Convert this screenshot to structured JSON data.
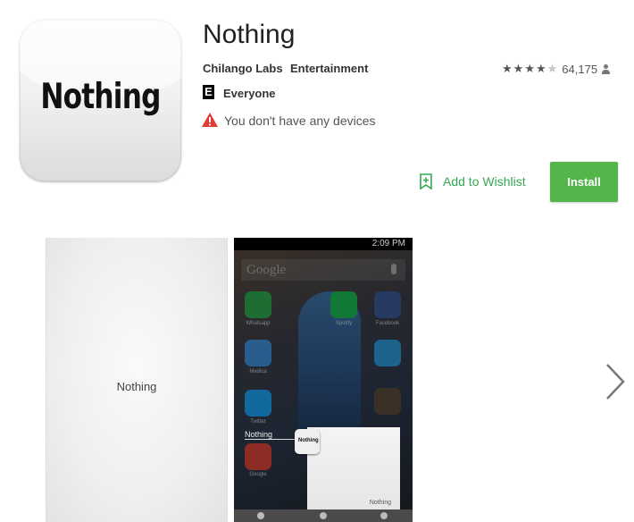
{
  "app": {
    "icon_text": "Nothing",
    "title": "Nothing",
    "developer": "Chilango Labs",
    "category": "Entertainment",
    "rating_stars": 4,
    "rating_count": "64,175",
    "content_rating": "Everyone",
    "content_rating_badge": "E",
    "device_warning": "You don't have any devices"
  },
  "actions": {
    "wishlist_label": "Add to Wishlist",
    "install_label": "Install"
  },
  "screenshots": {
    "first_caption": "Nothing",
    "second": {
      "status_time": "2:09 PM",
      "search_text": "Google",
      "app_labels": [
        "Whatsapp",
        "Spotify",
        "Facebook",
        "Medica",
        "Twitter",
        "Google"
      ],
      "mini_text": "Nothing",
      "mini_icon_text": "Nothing",
      "card_text": "Nothing"
    }
  },
  "colors": {
    "install_green": "#54b64a",
    "wishlist_green": "#33a852",
    "warning_red": "#e53935"
  },
  "icons": [
    "warning-icon",
    "bookmark-plus-icon",
    "person-icon",
    "chevron-right-icon",
    "star-icon"
  ]
}
